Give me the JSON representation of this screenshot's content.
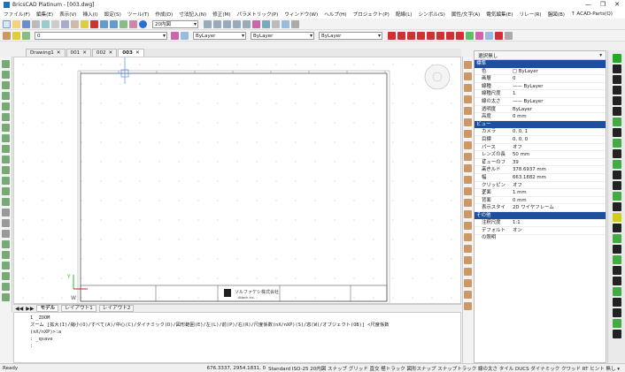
{
  "window": {
    "title": "BricsCAD Platinum - [003.dwg]",
    "minimize": "—",
    "maximize": "❐",
    "close": "✕"
  },
  "menu": [
    "ファイル(F)",
    "編集(E)",
    "表示(V)",
    "挿入(I)",
    "設定(S)",
    "ツール(T)",
    "作成(D)",
    "寸法記入(N)",
    "修正(M)",
    "パラメトリック(P)",
    "ウィンドウ(W)",
    "ヘルプ(H)",
    "プロジェクト(P)",
    "配線(L)",
    "シンボル(S)",
    "属性/文字(A)",
    "電気編集(E)",
    "リレー(R)",
    "盤図(B)",
    "↑ ACAD-Parts(Q)"
  ],
  "toolbar": {
    "textstyle": "20内図",
    "layer": "0",
    "color": "ByLayer",
    "linetype": "ByLayer",
    "lineweight": "ByLayer"
  },
  "tabs": [
    {
      "label": "Drawing1"
    },
    {
      "label": "001"
    },
    {
      "label": "002"
    },
    {
      "label": "003"
    }
  ],
  "layouts": [
    "モデル",
    "レイアウト1",
    "レイアウト2"
  ],
  "titleblock": {
    "company": "ソルファケシ株式会社",
    "subtitle": "Attach Inc."
  },
  "command": {
    "lines": [
      "1 _ZOOM",
      "ズーム [拡大(I)/縮小(O)/すべて(A)/中心(C)/ダイナミック(D)/図形範囲(E)/左(L)/前(P)/右(R)/尺度係数(nX/nXP)(S)/窓(W)/オブジェクト(OB)] <尺度係数",
      "(nX/nXP)>:a",
      ": _qsave"
    ],
    "prompt": ":"
  },
  "status": {
    "ready": "Ready",
    "coords": "676.3337, 2954.1831, 0",
    "items": "Standard  ISO-25  20内図  スナップ  グリッド  直交  極トラック  図形スナップ  スナップトラック  線の太さ  タイル  DUCS  ダイナミック  クワッド  RT  ヒント  無し ▾"
  },
  "properties": {
    "header": "選択無し",
    "rows": [
      {
        "type": "section",
        "label": "標準"
      },
      {
        "k": "色",
        "v": "□ ByLayer"
      },
      {
        "k": "画層",
        "v": "0"
      },
      {
        "k": "線種",
        "v": "—— ByLayer"
      },
      {
        "k": "線種尺度",
        "v": "1"
      },
      {
        "k": "線の太さ",
        "v": "—— ByLayer"
      },
      {
        "k": "透明度",
        "v": "ByLayer"
      },
      {
        "k": "高度",
        "v": "0 mm"
      },
      {
        "type": "section",
        "label": "ビュー"
      },
      {
        "k": "カメラ",
        "v": "0, 0, 1"
      },
      {
        "k": "目標",
        "v": "0, 0, 0"
      },
      {
        "k": "パース",
        "v": "オフ"
      },
      {
        "k": "レンズの長さ",
        "v": "50 mm"
      },
      {
        "k": "ビューのフィールド",
        "v": "39"
      },
      {
        "k": "高さ",
        "v": "378.6937 mm"
      },
      {
        "k": "幅",
        "v": "663.1882 mm"
      },
      {
        "k": "クリッピング",
        "v": "オフ"
      },
      {
        "k": "正面",
        "v": "1 mm"
      },
      {
        "k": "背面",
        "v": "0 mm"
      },
      {
        "k": "表示スタイル",
        "v": "2D ワイヤフレーム"
      },
      {
        "type": "section",
        "label": "その他"
      },
      {
        "k": "注釈尺度",
        "v": "1:1"
      },
      {
        "k": "デフォルトの照明",
        "v": "オン"
      }
    ]
  },
  "colors": {
    "accent": "#1e4f9c",
    "red": "#cc2222"
  }
}
